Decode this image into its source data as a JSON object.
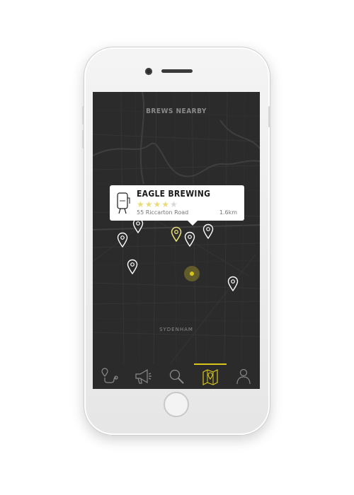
{
  "screen": {
    "title": "BREWS NEARBY",
    "district_label": "SYDENHAM"
  },
  "popup": {
    "name": "EAGLE BREWING",
    "rating": 4,
    "rating_max": 5,
    "stars_filled": "★★★★",
    "stars_empty": "★",
    "address": "55 Riccarton Road",
    "distance": "1.6km"
  },
  "colors": {
    "accent": "#d8c51a",
    "map_bg": "#2b2b2b",
    "pin_default": "#ffffff",
    "pin_selected": "#e8dc7a"
  },
  "tabs": [
    {
      "icon": "route-icon",
      "active": false
    },
    {
      "icon": "megaphone-icon",
      "active": false
    },
    {
      "icon": "search-icon",
      "active": false
    },
    {
      "icon": "map-pin-icon",
      "active": true
    },
    {
      "icon": "profile-icon",
      "active": false
    }
  ]
}
